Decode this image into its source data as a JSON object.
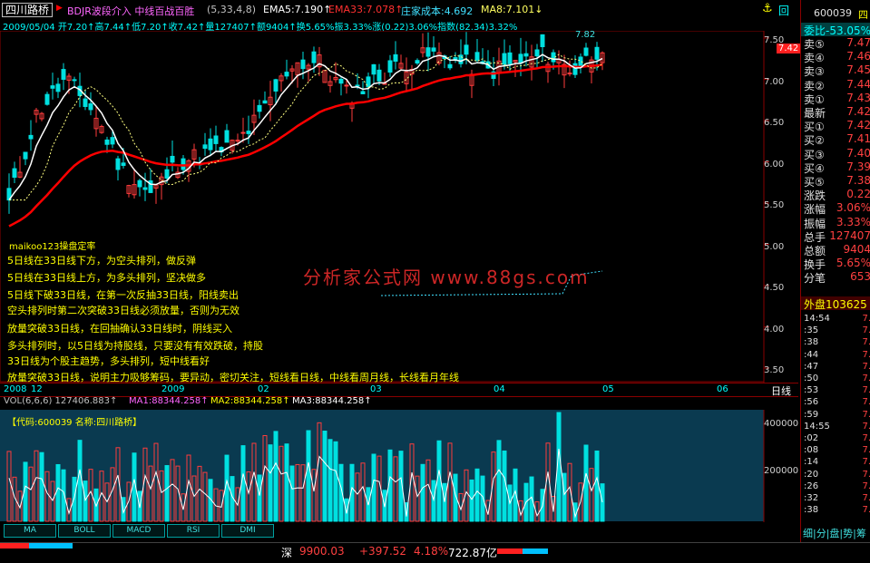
{
  "header": {
    "stock_name": "四川路桥",
    "indicator_name": "BDJR波段介入 中线百战百胜",
    "indicator_params": "(5,33,4,8)",
    "ema5": "EMA5:7.190↑",
    "ema33": "EMA33:7.078↑",
    "zhuang": "庄家成本:4.692",
    "ma8": "MA8:7.101↓",
    "info_line": "2009/05/04  开7.20↑高7.44↑低7.20↑收7.42↑量127407↑额9404↑换5.65%振3.33%涨(0.22)3.06%指数(82.34)3.32%"
  },
  "price_axis": [
    "7.50",
    "7.00",
    "6.50",
    "6.00",
    "5.50",
    "5.00",
    "4.50",
    "4.00",
    "3.50"
  ],
  "current_price_tag": "7.42",
  "high_marker": "7.82",
  "low_marker": "maikoo123操盘定率",
  "watermark": "分析家公式网 www.88gs.com",
  "notes": [
    "5日线在33日线下方，为空头排列，做反弹",
    "5日线在33日线上方，为多头排列，坚决做多",
    "5日线下破33日线，在第一次反抽33日线，阳线卖出",
    "空头排列时第二次突破33日线必须放量，否则为无效",
    "放量突破33日线，在回抽确认33日线时，阴线买入",
    "多头排列时，以5日线为持股线，只要没有有效跌破，持股",
    "33日线为个股主趋势，多头排列，短中线看好",
    "放量突破33日线，说明主力吸够筹码，要异动，密切关注，短线看日线，中线看周月线，长线看月年线"
  ],
  "date_axis": [
    "2008",
    "12",
    "2009",
    "02",
    "03",
    "04",
    "05",
    "06"
  ],
  "period_label": "日线",
  "vol_header": {
    "vol": "VOL(6,6,6)  127406.883↑",
    "ma1": "MA1:88344.258↑",
    "ma2": "MA2:88344.258↑",
    "ma3": "MA3:88344.258↑"
  },
  "vol_code_label": "【代码:600039 名称:四川路桥】",
  "vol_axis": [
    "400000",
    "200000"
  ],
  "tabs": [
    "MA",
    "BOLL",
    "MACD",
    "RSI",
    "DMI"
  ],
  "right_panel": {
    "code": "600039",
    "code_suffix": "四",
    "weibi": "委比-53.05%",
    "rows": [
      {
        "label": "卖⑤",
        "value": "7.47"
      },
      {
        "label": "卖④",
        "value": "7.46"
      },
      {
        "label": "卖③",
        "value": "7.45"
      },
      {
        "label": "卖②",
        "value": "7.44"
      },
      {
        "label": "卖①",
        "value": "7.43"
      },
      {
        "label": "最新",
        "value": "7.42"
      },
      {
        "label": "买①",
        "value": "7.42"
      },
      {
        "label": "买②",
        "value": "7.41"
      },
      {
        "label": "买③",
        "value": "7.40"
      },
      {
        "label": "买④",
        "value": "7.39"
      },
      {
        "label": "买⑤",
        "value": "7.38"
      },
      {
        "label": "涨跌",
        "value": "0.22"
      },
      {
        "label": "涨幅",
        "value": "3.06%"
      },
      {
        "label": "振幅",
        "value": "3.33%"
      },
      {
        "label": "总手",
        "value": "127407"
      },
      {
        "label": "总额",
        "value": "9404"
      },
      {
        "label": "换手",
        "value": "5.65%"
      },
      {
        "label": "分笔",
        "value": "653"
      }
    ],
    "outer": "外盘103625",
    "ticks": [
      {
        "time": "14:54",
        "price": "7."
      },
      {
        "time": ":35",
        "price": "7."
      },
      {
        "time": ":38",
        "price": "7."
      },
      {
        "time": ":44",
        "price": "7."
      },
      {
        "time": ":47",
        "price": "7."
      },
      {
        "time": ":50",
        "price": "7."
      },
      {
        "time": ":53",
        "price": "7."
      },
      {
        "time": ":56",
        "price": "7."
      },
      {
        "time": ":59",
        "price": "7."
      },
      {
        "time": "14:55",
        "price": "7."
      },
      {
        "time": ":02",
        "price": "7."
      },
      {
        "time": ":08",
        "price": "7."
      },
      {
        "time": ":14",
        "price": "7."
      },
      {
        "time": ":20",
        "price": "7."
      },
      {
        "time": ":26",
        "price": "7."
      },
      {
        "time": ":32",
        "price": "7."
      },
      {
        "time": ":38",
        "price": "7."
      }
    ],
    "footer": "细|分|盘|势|筹"
  },
  "bottom": {
    "market": "深",
    "index": "9900.03",
    "change": "+397.52",
    "pct": "4.18%",
    "amount": "722.87亿"
  },
  "colors": {
    "up": "#ff3c3c",
    "down": "#00e0e0",
    "ema5": "#ffffff",
    "ema33": "#ff0000",
    "text_yellow": "#ffff00"
  }
}
